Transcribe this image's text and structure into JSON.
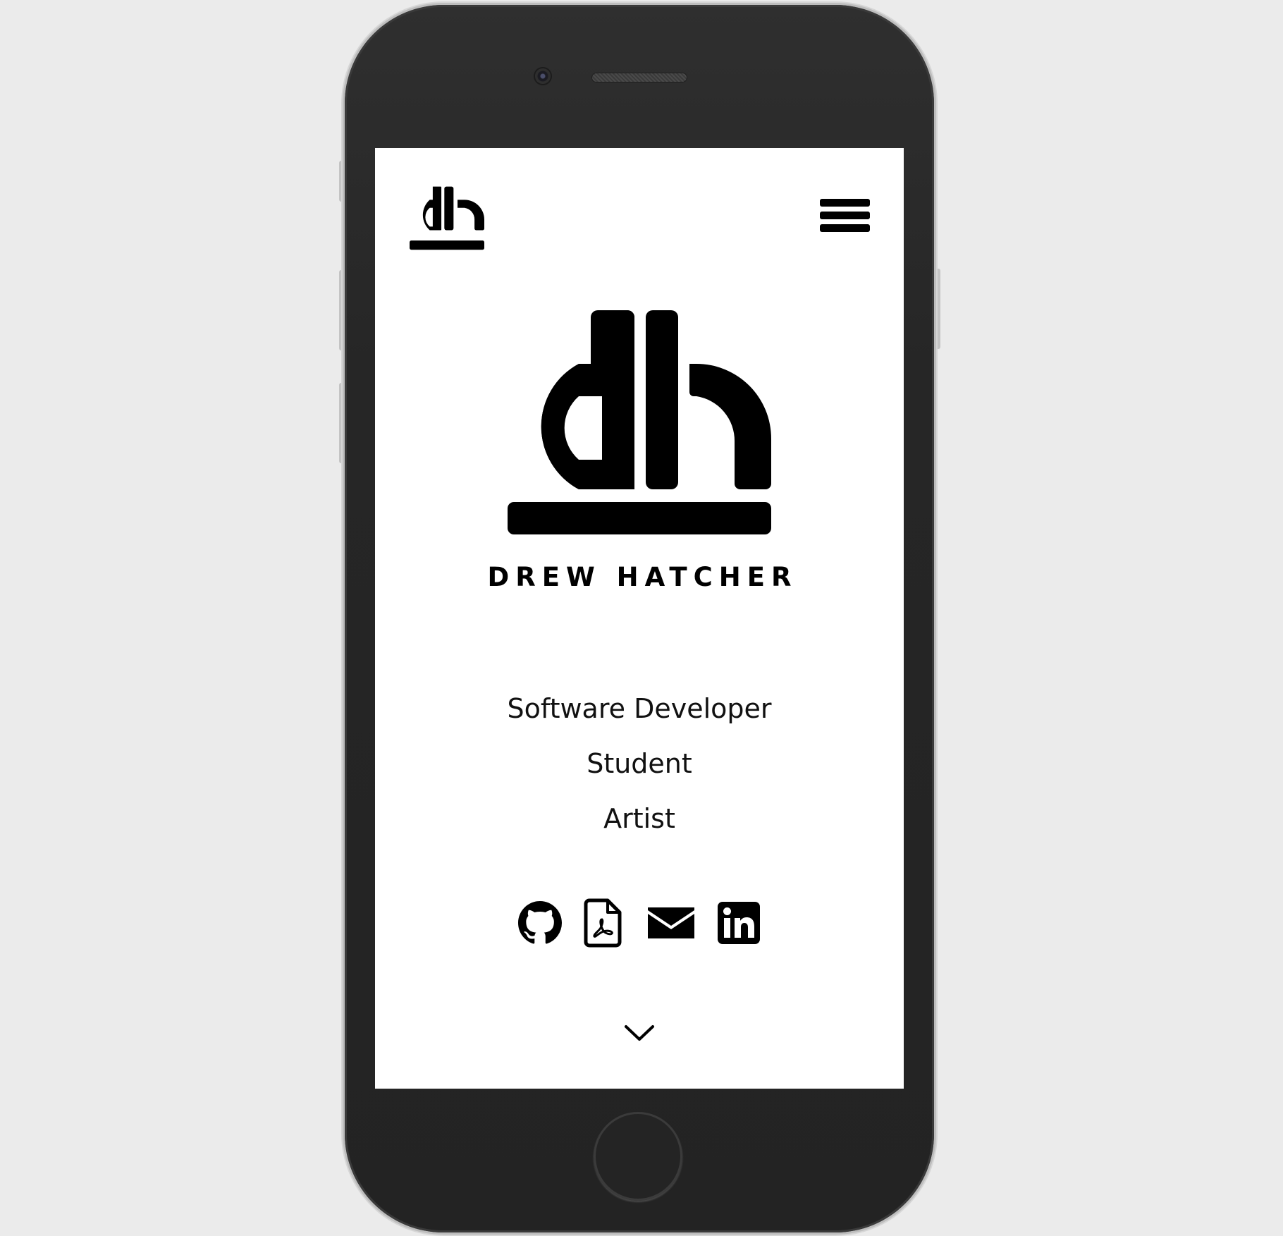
{
  "header": {
    "logo_icon": "dh-monogram-icon",
    "menu_icon": "hamburger-menu-icon"
  },
  "hero": {
    "logo_icon": "dh-monogram-icon",
    "name": "DREW HATCHER",
    "roles": [
      "Software Developer",
      "Student",
      "Artist"
    ]
  },
  "social": {
    "links": [
      {
        "icon": "github-icon"
      },
      {
        "icon": "pdf-resume-icon"
      },
      {
        "icon": "email-icon"
      },
      {
        "icon": "linkedin-icon"
      }
    ]
  },
  "scroll": {
    "icon": "chevron-down-icon"
  },
  "colors": {
    "background": "#ebebeb",
    "phone_body": "#262626",
    "screen": "#ffffff",
    "ink": "#000000"
  }
}
